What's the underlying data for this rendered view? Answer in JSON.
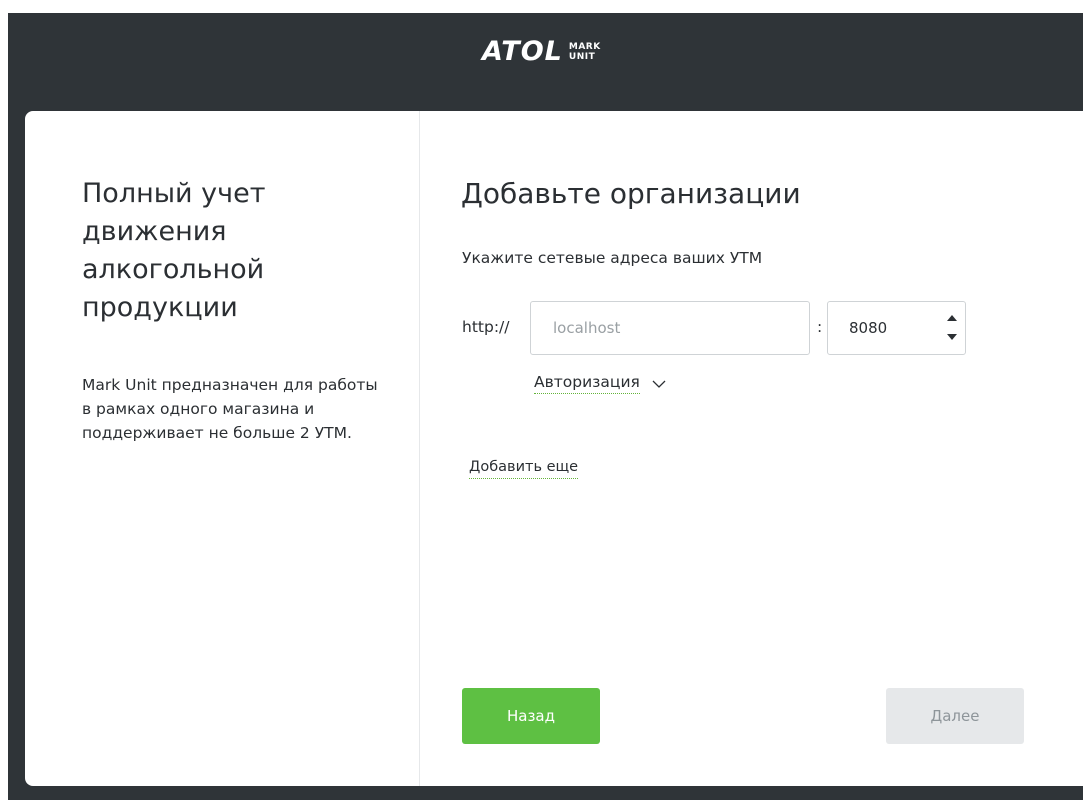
{
  "header": {
    "logo_main": "ATOL",
    "logo_sub_top": "MARK",
    "logo_sub_bottom": "UNIT"
  },
  "left_panel": {
    "title": "Полный учет движения алкогольной продукции",
    "description": "Mark Unit предназначен для работы в рамках одного магазина и поддерживает не больше 2 УТМ."
  },
  "right_panel": {
    "title": "Добавьте организации",
    "subtitle": "Укажите сетевые адреса ваших УТМ",
    "protocol": "http://",
    "host_placeholder": "localhost",
    "host_value": "",
    "colon": ":",
    "port_value": "8080",
    "auth_label": "Авторизация",
    "add_more_label": "Добавить еще"
  },
  "buttons": {
    "back_label": "Назад",
    "next_label": "Далее"
  },
  "colors": {
    "header_bg": "#2f3438",
    "accent_green": "#5ec043",
    "disabled_gray": "#e6e8ea"
  }
}
